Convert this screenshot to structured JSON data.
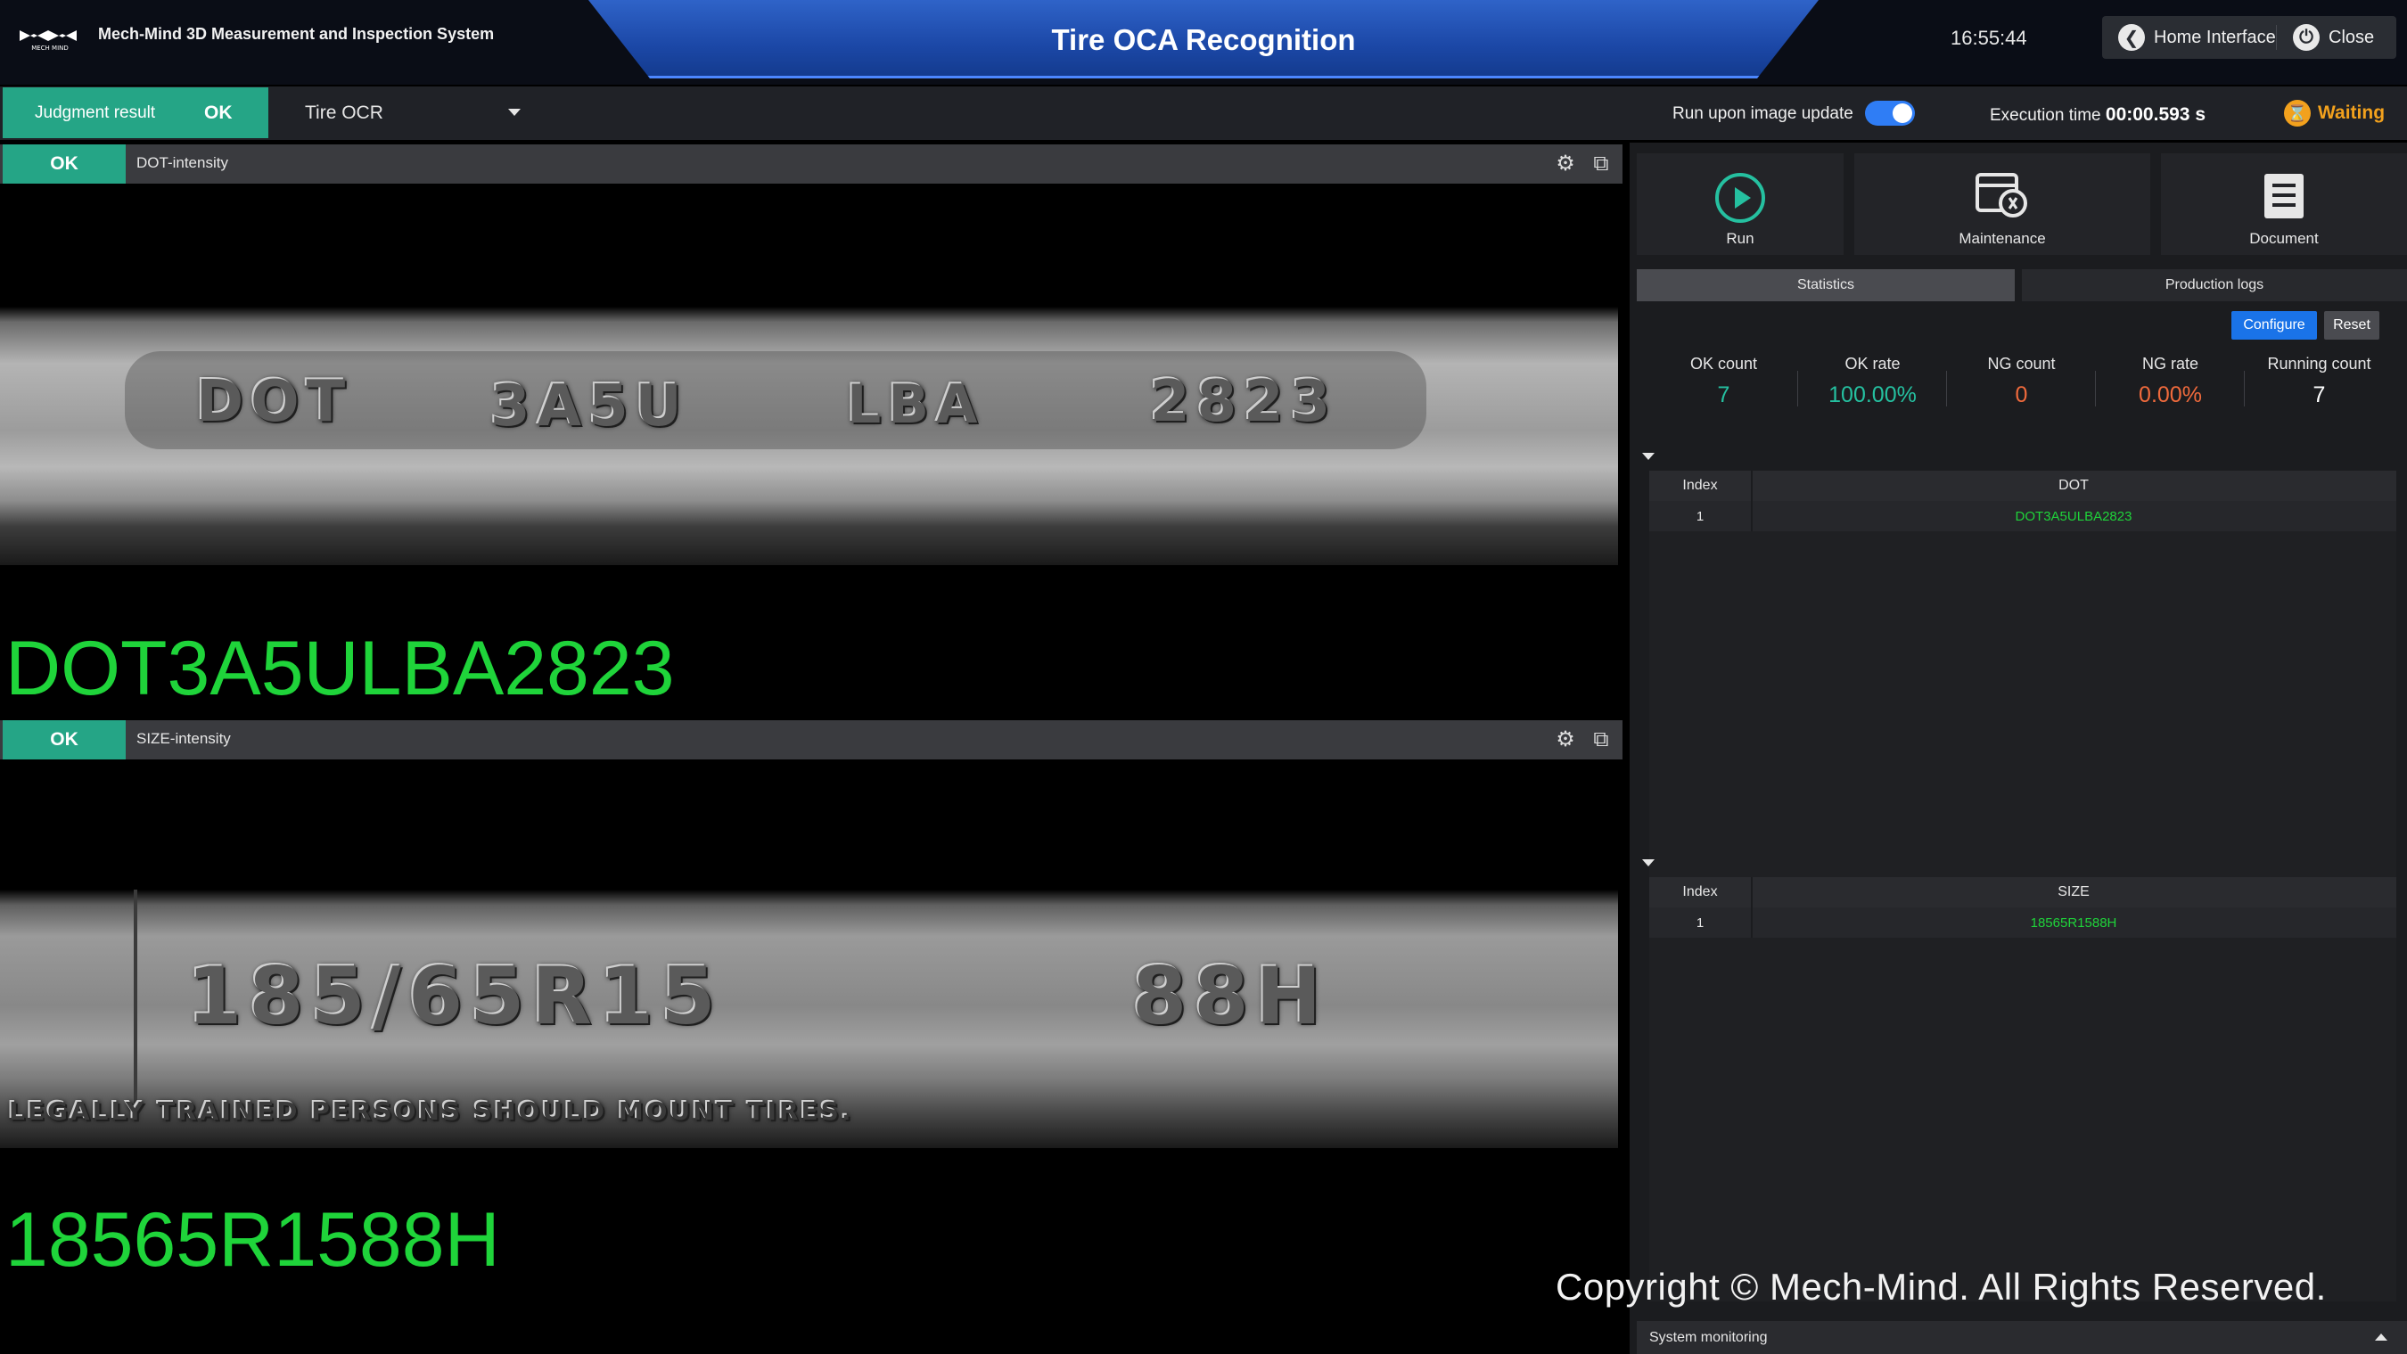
{
  "header": {
    "logo_text": "MECH MIND",
    "app_name": "Mech-Mind 3D Measurement and Inspection System",
    "title": "Tire OCA Recognition",
    "time": "16:55:44",
    "home_label": "Home Interface",
    "close_label": "Close"
  },
  "toolbar": {
    "judgment_label": "Judgment result",
    "judgment_value": "OK",
    "project_select": "Tire OCR",
    "run_upon_label": "Run upon image update",
    "run_upon_enabled": true,
    "exec_label": "Execution time",
    "exec_value": "00:00.593 s",
    "status": "Waiting"
  },
  "panels": [
    {
      "badge": "OK",
      "title": "DOT-intensity",
      "tire_text": [
        "DOT",
        "3A5U",
        "LBA",
        "2823"
      ],
      "result": "DOT3A5ULBA2823"
    },
    {
      "badge": "OK",
      "title": "SIZE-intensity",
      "tire_text": [
        "185/65R15",
        "88H"
      ],
      "tire_subtext": "LEGALLY TRAINED PERSONS SHOULD MOUNT TIRES.",
      "result": "18565R1588H"
    }
  ],
  "tools": {
    "run": "Run",
    "maintenance": "Maintenance",
    "document": "Document"
  },
  "tabs": {
    "statistics": "Statistics",
    "logs": "Production logs"
  },
  "buttons": {
    "configure": "Configure",
    "reset": "Reset"
  },
  "stats": [
    {
      "label": "OK count",
      "value": "7",
      "color": "#25c0a0"
    },
    {
      "label": "OK rate",
      "value": "100.00%",
      "color": "#25c0a0"
    },
    {
      "label": "NG count",
      "value": "0",
      "color": "#f06a3c"
    },
    {
      "label": "NG rate",
      "value": "0.00%",
      "color": "#f06a3c"
    },
    {
      "label": "Running count",
      "value": "7",
      "color": "#ffffff"
    }
  ],
  "dot_table": {
    "col_index": "Index",
    "col_value": "DOT",
    "rows": [
      {
        "index": "1",
        "value": "DOT3A5ULBA2823"
      }
    ]
  },
  "size_table": {
    "col_index": "Index",
    "col_value": "SIZE",
    "rows": [
      {
        "index": "1",
        "value": "18565R1588H"
      }
    ]
  },
  "copyright": "Copyright © Mech-Mind. All Rights Reserved.",
  "system_monitoring": "System monitoring",
  "colors": {
    "accent_green": "#25a586",
    "result_green": "#1fd43a",
    "accent_blue": "#1a73e8",
    "warning": "#f2a11d"
  }
}
